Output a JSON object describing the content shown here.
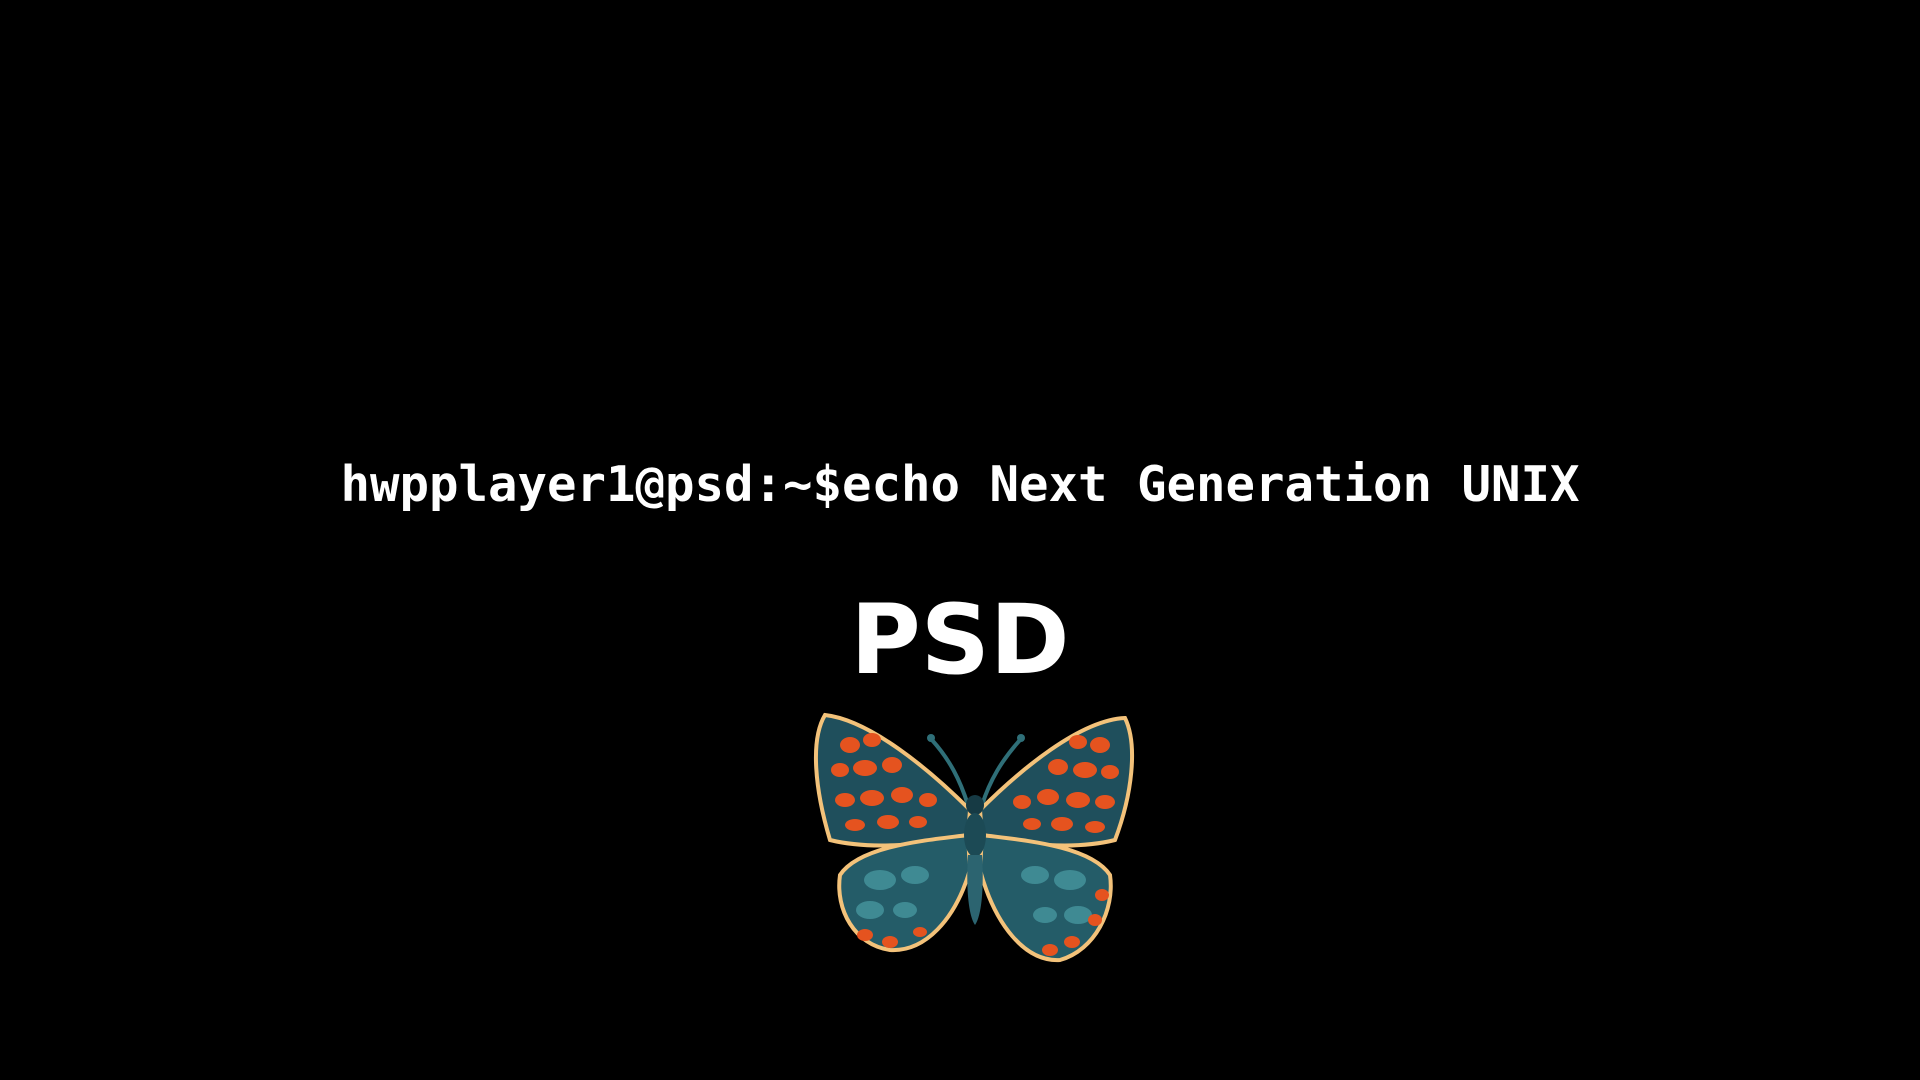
{
  "terminal": {
    "prompt": "hwpplayer1@psd:~$",
    "command": "echo Next Generation UNIX"
  },
  "brand": {
    "name": "PSD"
  },
  "logo": {
    "icon": "butterfly-icon",
    "colors": {
      "wing_dark": "#1f4f5c",
      "wing_teal": "#3f8a93",
      "wing_orange": "#e5531f",
      "wing_edge": "#f3c27a",
      "body": "#163a44"
    }
  },
  "colors": {
    "background": "#000000",
    "text": "#ffffff"
  }
}
